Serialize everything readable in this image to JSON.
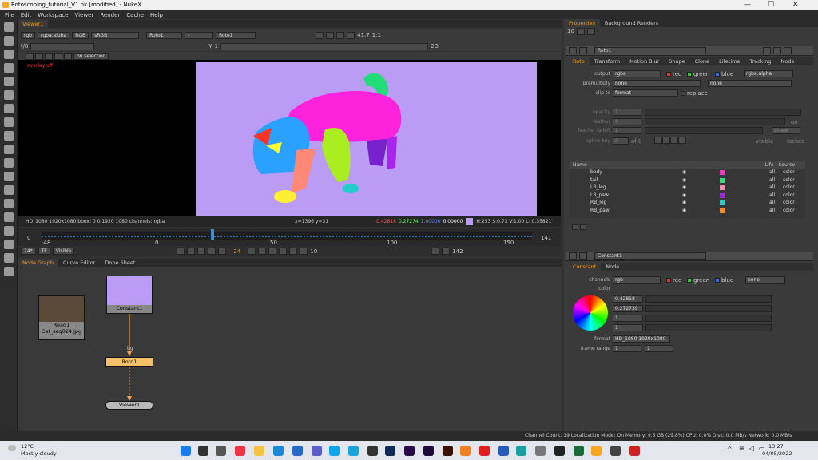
{
  "window": {
    "title": "Rotoscoping_tutorial_V1.nk [modified] - NukeX",
    "minimize": "—",
    "maximize": "☐",
    "close": "✕"
  },
  "menu": [
    "File",
    "Edit",
    "Workspace",
    "Viewer",
    "Render",
    "Cache",
    "Help"
  ],
  "viewer": {
    "tab": "Viewer1",
    "channels": "rgb",
    "alpha": "rgba.alpha",
    "display": "RGB",
    "colorspace": "sRGB",
    "a_input": "Roto1",
    "b_input": "Roto1",
    "op": "-",
    "fstop": "f/8",
    "frame_incr": "1",
    "y": "Y",
    "y_val": "1",
    "zoom": "41.7",
    "ratio": "1:1",
    "proxy": "2D",
    "on_selection": "on selection",
    "overlay": "overlay off",
    "info": "HD_1080 1920x1080  bbox: 0 0 1920 1080 channels: rgba",
    "coords": "x=1396 y=31",
    "pix_r": "0.42818",
    "pix_g": "0.27274",
    "pix_b": "1.00000",
    "pix_a": "0.00000",
    "hsv": "H:253 S:0.73 V:1.00  L: 0.35821",
    "timeline": {
      "start": "0",
      "end": "141",
      "ticks": [
        "-48",
        "0",
        "50",
        "100",
        "150"
      ],
      "right": "141"
    },
    "playback": {
      "fps": "24*",
      "tf": "TF",
      "visible": "Visible",
      "frame": "24",
      "step": "10",
      "end": "142"
    }
  },
  "nodegraph": {
    "tabs": [
      "Node Graph",
      "Curve Editor",
      "Dope Sheet"
    ],
    "nodes": {
      "read": "Read1",
      "read_file": "Cat_seq024.jpg",
      "constant": "Constant1",
      "roto": "Roto1",
      "viewer": "Viewer1"
    },
    "pipe_label": "bg"
  },
  "properties": {
    "tabs": [
      "Properties",
      "Background Renders"
    ],
    "max_panels": "10",
    "roto": {
      "name": "Roto1",
      "tabs": [
        "Roto",
        "Transform",
        "Motion Blur",
        "Shape",
        "Clone",
        "Lifetime",
        "Tracking",
        "Node"
      ],
      "output_label": "output",
      "output": "rgba",
      "red": "red",
      "green": "green",
      "blue": "blue",
      "output_mask": "rgba.alpha",
      "premult_label": "premultiply",
      "premult": "none",
      "premult2": "none",
      "clipto_label": "clip to",
      "clipto": "format",
      "replace": "replace",
      "opacity_label": "opacity",
      "opacity": "1",
      "feather_label": "feather",
      "feather": "0",
      "on": "on",
      "falloff_label": "feather falloff",
      "falloff": "1",
      "falloff_type": "Linear",
      "spline_label": "spline key",
      "spline_key": "0",
      "spline_of": "of 0",
      "visible": "visible",
      "locked": "locked",
      "slider_ticks": [
        "0",
        "0.1",
        "0.2",
        "0.3",
        "0.4",
        "0.5",
        "0.6",
        "0.7",
        "0.8",
        "0.9",
        "1"
      ],
      "list_headers": [
        "Name",
        "Life",
        "Source"
      ],
      "shapes": [
        {
          "name": "body",
          "color": "#ff33cc",
          "life": "all",
          "source": "color"
        },
        {
          "name": "tail",
          "color": "#33dd77",
          "life": "all",
          "source": "color"
        },
        {
          "name": "LB_leg",
          "color": "#ff88aa",
          "life": "all",
          "source": "color"
        },
        {
          "name": "LB_paw",
          "color": "#aa22ee",
          "life": "all",
          "source": "color"
        },
        {
          "name": "RB_leg",
          "color": "#22cccc",
          "life": "all",
          "source": "color"
        },
        {
          "name": "RB_paw",
          "color": "#ff8822",
          "life": "all",
          "source": "color"
        }
      ]
    },
    "constant": {
      "name": "Constant1",
      "tabs": [
        "Constant",
        "Node"
      ],
      "channels_label": "channels",
      "channels": "rgb",
      "red": "red",
      "green": "green",
      "blue": "blue",
      "none": "none",
      "color_label": "color",
      "r": "0.42818",
      "g": "0.272739",
      "b": "1",
      "a": "1",
      "format_label": "format",
      "format": "HD_1080 1920x1080",
      "framerange_label": "frame range",
      "frame_start": "1",
      "frame_end": "1"
    }
  },
  "status": "Channel Count: 19  Localization Mode: On  Memory: 9.5 GB (29.8%)  CPU: 0.0%  Disk: 0.0 MB/s  Network: 0.0 MB/s",
  "taskbar": {
    "temp": "12°C",
    "weather": "Mostly cloudy",
    "time": "13:27",
    "date": "04/05/2022"
  },
  "colors": {
    "frame_bg": "#bb9cf5",
    "accent": "#f0a020",
    "roto_node": "#f4c068",
    "constant_swatch": "#bb9cf5"
  }
}
